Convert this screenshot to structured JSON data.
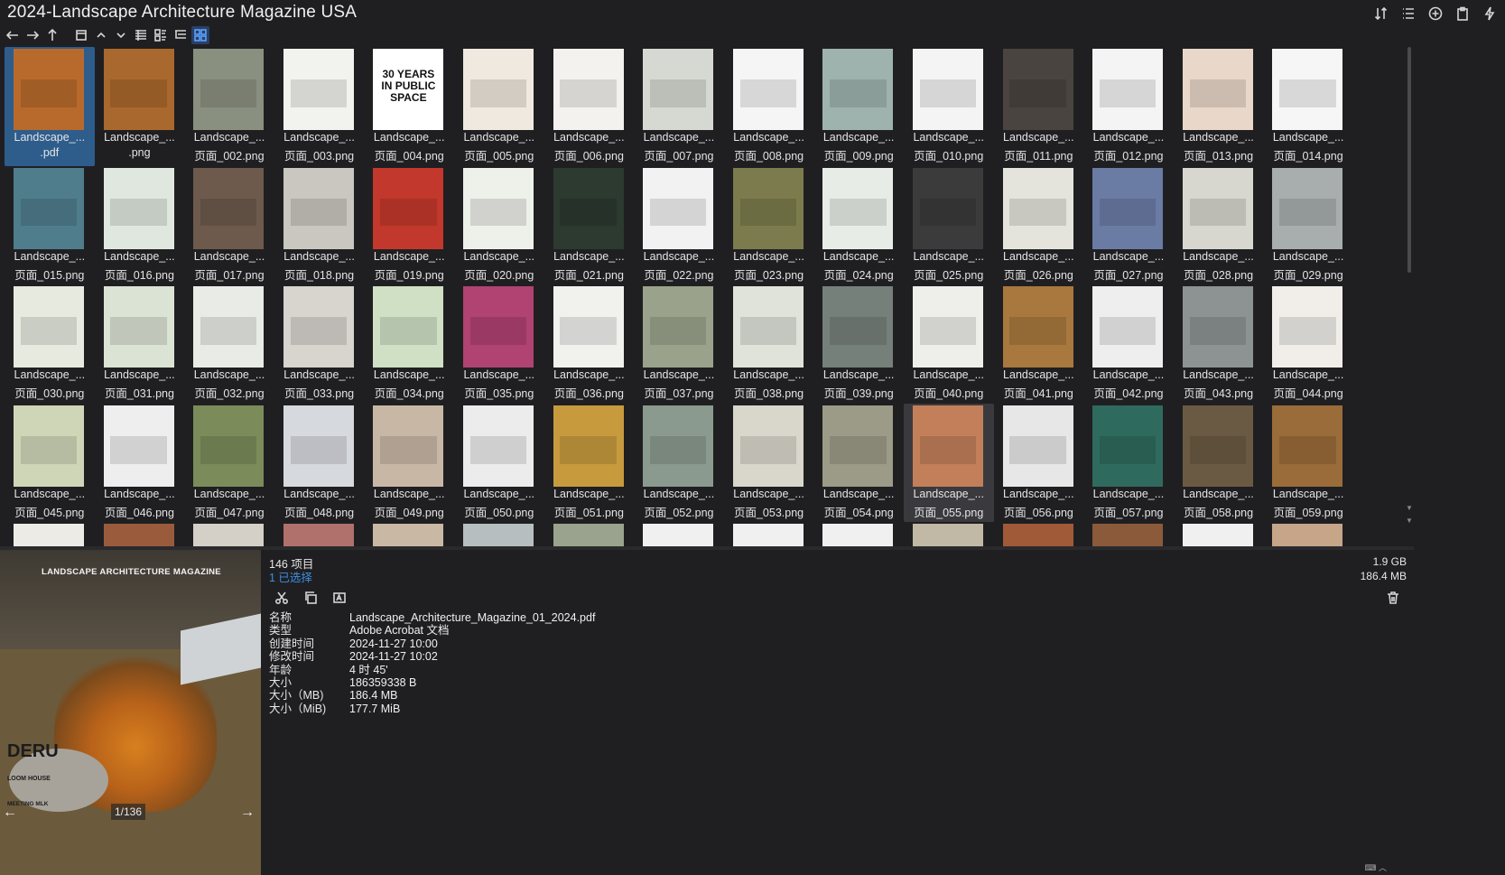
{
  "window": {
    "title": "2024-Landscape Architecture Magazine USA"
  },
  "title_tools": [
    "sort-icon",
    "list-view-icon",
    "add-icon",
    "clipboard-icon",
    "bolt-icon"
  ],
  "toolbar": [
    "back-arrow-icon",
    "forward-arrow-icon",
    "up-arrow-icon",
    "window-icon",
    "chevron-up-icon",
    "chevron-down-icon",
    "details-view-icon",
    "tiles-view-icon",
    "list-tree-view-icon",
    "grid-view-icon"
  ],
  "files": [
    {
      "line1": "Landscape_...",
      "line2": ".pdf",
      "selected": true,
      "color": "#b86a2c"
    },
    {
      "line1": "Landscape_...",
      "line2": ".png",
      "color": "#a9682d"
    },
    {
      "line1": "Landscape_...",
      "line2": "页面_002.png",
      "color": "#8a9080"
    },
    {
      "line1": "Landscape_...",
      "line2": "页面_003.png",
      "color": "#f2f2ee"
    },
    {
      "line1": "Landscape_...",
      "line2": "页面_004.png",
      "color": "#ffffff",
      "text": "30 YEARS IN PUBLIC SPACE"
    },
    {
      "line1": "Landscape_...",
      "line2": "页面_005.png",
      "color": "#efe9df"
    },
    {
      "line1": "Landscape_...",
      "line2": "页面_006.png",
      "color": "#f4f2ee"
    },
    {
      "line1": "Landscape_...",
      "line2": "页面_007.png",
      "color": "#d6d9d2"
    },
    {
      "line1": "Landscape_...",
      "line2": "页面_008.png",
      "color": "#f5f5f5"
    },
    {
      "line1": "Landscape_...",
      "line2": "页面_009.png",
      "color": "#9fb3ae"
    },
    {
      "line1": "Landscape_...",
      "line2": "页面_010.png",
      "color": "#f4f4f4"
    },
    {
      "line1": "Landscape_...",
      "line2": "页面_011.png",
      "color": "#4a4440"
    },
    {
      "line1": "Landscape_...",
      "line2": "页面_012.png",
      "color": "#f4f4f4"
    },
    {
      "line1": "Landscape_...",
      "line2": "页面_013.png",
      "color": "#e9d7c9"
    },
    {
      "line1": "Landscape_...",
      "line2": "页面_014.png",
      "color": "#f6f6f6"
    },
    {
      "line1": "Landscape_...",
      "line2": "页面_015.png",
      "color": "#4f7d8c"
    },
    {
      "line1": "Landscape_...",
      "line2": "页面_016.png",
      "color": "#dfe7df"
    },
    {
      "line1": "Landscape_...",
      "line2": "页面_017.png",
      "color": "#6d5a4c"
    },
    {
      "line1": "Landscape_...",
      "line2": "页面_018.png",
      "color": "#c9c7bf"
    },
    {
      "line1": "Landscape_...",
      "line2": "页面_019.png",
      "color": "#c3382c"
    },
    {
      "line1": "Landscape_...",
      "line2": "页面_020.png",
      "color": "#eef0ea"
    },
    {
      "line1": "Landscape_...",
      "line2": "页面_021.png",
      "color": "#2c3a2f"
    },
    {
      "line1": "Landscape_...",
      "line2": "页面_022.png",
      "color": "#f2f2f2"
    },
    {
      "line1": "Landscape_...",
      "line2": "页面_023.png",
      "color": "#7b7b4d"
    },
    {
      "line1": "Landscape_...",
      "line2": "页面_024.png",
      "color": "#e7ede6"
    },
    {
      "line1": "Landscape_...",
      "line2": "页面_025.png",
      "color": "#3b3b3b"
    },
    {
      "line1": "Landscape_...",
      "line2": "页面_026.png",
      "color": "#e4e4dc"
    },
    {
      "line1": "Landscape_...",
      "line2": "页面_027.png",
      "color": "#6a7ba4"
    },
    {
      "line1": "Landscape_...",
      "line2": "页面_028.png",
      "color": "#d7d7cf"
    },
    {
      "line1": "Landscape_...",
      "line2": "页面_029.png",
      "color": "#a8adae"
    },
    {
      "line1": "Landscape_...",
      "line2": "页面_030.png",
      "color": "#e6eadf"
    },
    {
      "line1": "Landscape_...",
      "line2": "页面_031.png",
      "color": "#dbe3d4"
    },
    {
      "line1": "Landscape_...",
      "line2": "页面_032.png",
      "color": "#e9ece6"
    },
    {
      "line1": "Landscape_...",
      "line2": "页面_033.png",
      "color": "#d8d4ce"
    },
    {
      "line1": "Landscape_...",
      "line2": "页面_034.png",
      "color": "#cfe0c4"
    },
    {
      "line1": "Landscape_...",
      "line2": "页面_035.png",
      "color": "#b04372"
    },
    {
      "line1": "Landscape_...",
      "line2": "页面_036.png",
      "color": "#f1f1ee"
    },
    {
      "line1": "Landscape_...",
      "line2": "页面_037.png",
      "color": "#9aa28b"
    },
    {
      "line1": "Landscape_...",
      "line2": "页面_038.png",
      "color": "#dfe3da"
    },
    {
      "line1": "Landscape_...",
      "line2": "页面_039.png",
      "color": "#76807a"
    },
    {
      "line1": "Landscape_...",
      "line2": "页面_040.png",
      "color": "#eeeeea"
    },
    {
      "line1": "Landscape_...",
      "line2": "页面_041.png",
      "color": "#a8783e"
    },
    {
      "line1": "Landscape_...",
      "line2": "页面_042.png",
      "color": "#eeeeee"
    },
    {
      "line1": "Landscape_...",
      "line2": "页面_043.png",
      "color": "#8d9292"
    },
    {
      "line1": "Landscape_...",
      "line2": "页面_044.png",
      "color": "#f1eeea"
    },
    {
      "line1": "Landscape_...",
      "line2": "页面_045.png",
      "color": "#cfd6b8"
    },
    {
      "line1": "Landscape_...",
      "line2": "页面_046.png",
      "color": "#eeeeee"
    },
    {
      "line1": "Landscape_...",
      "line2": "页面_047.png",
      "color": "#7b8c5a"
    },
    {
      "line1": "Landscape_...",
      "line2": "页面_048.png",
      "color": "#d6d9de"
    },
    {
      "line1": "Landscape_...",
      "line2": "页面_049.png",
      "color": "#c9b7a6"
    },
    {
      "line1": "Landscape_...",
      "line2": "页面_050.png",
      "color": "#ececec"
    },
    {
      "line1": "Landscape_...",
      "line2": "页面_051.png",
      "color": "#c79a3e"
    },
    {
      "line1": "Landscape_...",
      "line2": "页面_052.png",
      "color": "#8a9a8e"
    },
    {
      "line1": "Landscape_...",
      "line2": "页面_053.png",
      "color": "#d9d6cc"
    },
    {
      "line1": "Landscape_...",
      "line2": "页面_054.png",
      "color": "#9c9b87"
    },
    {
      "line1": "Landscape_...",
      "line2": "页面_055.png",
      "hover": true,
      "color": "#c27f59"
    },
    {
      "line1": "Landscape_...",
      "line2": "页面_056.png",
      "color": "#e7e7e7"
    },
    {
      "line1": "Landscape_...",
      "line2": "页面_057.png",
      "color": "#2f6a5e"
    },
    {
      "line1": "Landscape_...",
      "line2": "页面_058.png",
      "color": "#6b5a43"
    },
    {
      "line1": "Landscape_...",
      "line2": "页面_059.png",
      "color": "#9a6c3a"
    },
    {
      "line1": "",
      "line2": "",
      "color": "#ecebe6"
    },
    {
      "line1": "",
      "line2": "",
      "color": "#9a5b3c"
    },
    {
      "line1": "",
      "line2": "",
      "color": "#d4d0c7"
    },
    {
      "line1": "",
      "line2": "",
      "color": "#b0706b"
    },
    {
      "line1": "",
      "line2": "",
      "color": "#c9b8a3"
    },
    {
      "line1": "",
      "line2": "",
      "color": "#b6bec0"
    },
    {
      "line1": "",
      "line2": "",
      "color": "#9aa38e"
    },
    {
      "line1": "",
      "line2": "",
      "color": "#f0f0f0"
    },
    {
      "line1": "",
      "line2": "",
      "color": "#f0f0f0"
    },
    {
      "line1": "",
      "line2": "",
      "color": "#f0f0f0"
    },
    {
      "line1": "",
      "line2": "",
      "color": "#c1b9a5"
    },
    {
      "line1": "",
      "line2": "",
      "color": "#a05a38"
    },
    {
      "line1": "",
      "line2": "",
      "color": "#8a5a3a"
    },
    {
      "line1": "",
      "line2": "",
      "color": "#f0f0f0"
    },
    {
      "line1": "",
      "line2": "",
      "color": "#c7a589"
    }
  ],
  "preview": {
    "magazine_title": "LANDSCAPE ARCHITECTURE MAGAZINE",
    "cover_word": "DERU",
    "cover_sub": "LOOM HOUSE",
    "cover_meet": "MEETING MLK",
    "page_indicator": "1/136",
    "prev": "←",
    "next": "→"
  },
  "details": {
    "item_count": "146 项目",
    "selected_count": "1 已选择",
    "total_size": "1.9 GB",
    "selected_size": "186.4 MB",
    "actions": [
      "cut-icon",
      "copy-icon",
      "rename-icon"
    ],
    "properties": [
      {
        "key": "名称",
        "value": "Landscape_Architecture_Magazine_01_2024.pdf"
      },
      {
        "key": "类型",
        "value": "Adobe Acrobat 文档"
      },
      {
        "key": "创建时间",
        "value": "2024-11-27  10:00"
      },
      {
        "key": "修改时间",
        "value": "2024-11-27  10:02"
      },
      {
        "key": "年龄",
        "value": "4 时 45'"
      },
      {
        "key": "大小",
        "value": "186359338 B"
      },
      {
        "key": "大小（MB)",
        "value": "186.4 MB"
      },
      {
        "key": "大小（MiB)",
        "value": "177.7 MiB"
      }
    ]
  }
}
